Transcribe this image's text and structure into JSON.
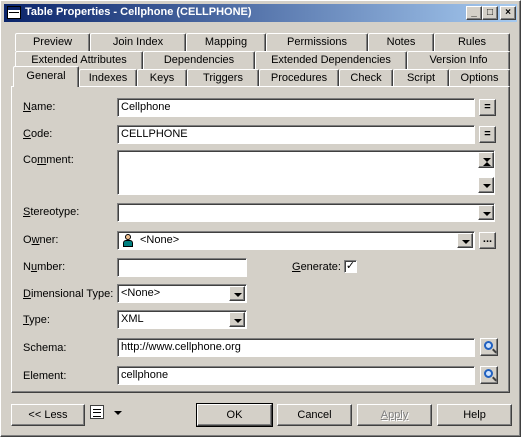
{
  "window": {
    "title": "Table Properties - Cellphone (CELLPHONE)",
    "minimize": "_",
    "maximize": "□",
    "close": "×"
  },
  "tabs": {
    "row1": [
      "Preview",
      "Join Index",
      "Mapping",
      "Permissions",
      "Notes",
      "Rules"
    ],
    "row2": [
      "Extended Attributes",
      "Dependencies",
      "Extended Dependencies",
      "Version Info"
    ],
    "row3": [
      "General",
      "Indexes",
      "Keys",
      "Triggers",
      "Procedures",
      "Check",
      "Script",
      "Options"
    ],
    "active": "General"
  },
  "form": {
    "name": {
      "label_u": "N",
      "label_rest": "ame:",
      "value": "Cellphone",
      "btn": "="
    },
    "code": {
      "label_u": "C",
      "label_rest": "ode:",
      "value": "CELLPHONE",
      "btn": "="
    },
    "comment": {
      "label_pre": "Co",
      "label_u": "m",
      "label_rest": "ment:",
      "value": ""
    },
    "stereotype": {
      "label_u": "S",
      "label_rest": "tereotype:",
      "value": ""
    },
    "owner": {
      "label_pre": "O",
      "label_u": "w",
      "label_rest": "ner:",
      "value": "<None>",
      "btn": "..."
    },
    "number": {
      "label_pre": "N",
      "label_u": "u",
      "label_rest": "mber:",
      "value": ""
    },
    "generate": {
      "label_u": "G",
      "label_rest": "enerate:",
      "checked": "✓"
    },
    "dimensional_type": {
      "label_u": "D",
      "label_rest": "imensional Type:",
      "value": "<None>"
    },
    "type": {
      "label_u": "T",
      "label_rest": "ype:",
      "value": "XML"
    },
    "schema": {
      "label": "Schema:",
      "value": "http://www.cellphone.org"
    },
    "element": {
      "label": "Element:",
      "value": "cellphone"
    }
  },
  "footer": {
    "less": "<< Less",
    "ok": "OK",
    "cancel": "Cancel",
    "apply": "Apply",
    "help": "Help"
  }
}
